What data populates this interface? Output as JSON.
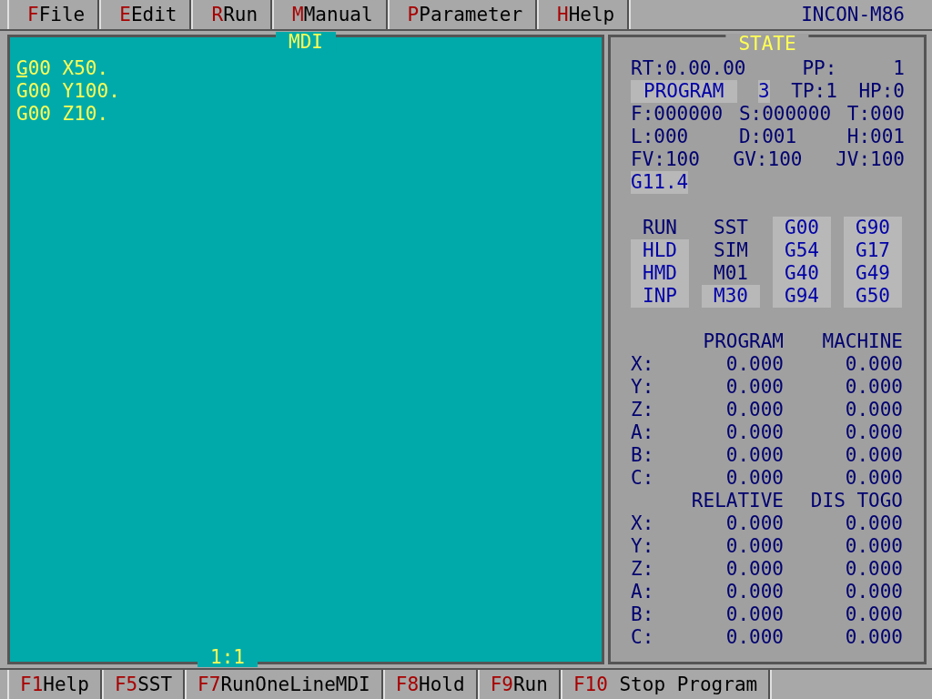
{
  "menu": [
    {
      "key": "F",
      "label": "File"
    },
    {
      "key": "E",
      "label": "Edit"
    },
    {
      "key": "R",
      "label": "Run"
    },
    {
      "key": "M",
      "label": "Manual"
    },
    {
      "key": "P",
      "label": "Parameter"
    },
    {
      "key": "H",
      "label": "Help"
    }
  ],
  "product": "INCON-M86",
  "editor": {
    "title": "MDI",
    "lines": [
      "G00 X50.",
      "G00 Y100.",
      "G00 Z10."
    ],
    "position": "1:1"
  },
  "state": {
    "title": "STATE",
    "rows": [
      [
        {
          "text": "RT:0.00.00",
          "on": false
        },
        {
          "text": "PP:",
          "on": false
        },
        {
          "text": "1",
          "on": false
        }
      ],
      [
        {
          "text": "PROGRAM",
          "on": true
        },
        {
          "text": "3",
          "on": true
        },
        {
          "text": "TP:1",
          "on": false
        },
        {
          "text": "HP:0",
          "on": false
        }
      ],
      [
        {
          "text": "F:000000",
          "on": false
        },
        {
          "text": "S:000000",
          "on": false
        },
        {
          "text": "T:000",
          "on": false
        }
      ],
      [
        {
          "text": "L:000",
          "on": false
        },
        {
          "text": "D:001",
          "on": false
        },
        {
          "text": "H:001",
          "on": false
        }
      ],
      [
        {
          "text": "FV:100",
          "on": false
        },
        {
          "text": "GV:100",
          "on": false
        },
        {
          "text": "JV:100",
          "on": false
        }
      ],
      [
        {
          "text": "G11.4",
          "on": true
        }
      ]
    ],
    "flags": [
      [
        {
          "text": "RUN",
          "on": false
        },
        {
          "text": "SST",
          "on": false
        },
        {
          "text": "G00",
          "on": true
        },
        {
          "text": "G90",
          "on": true
        }
      ],
      [
        {
          "text": "HLD",
          "on": true
        },
        {
          "text": "SIM",
          "on": false
        },
        {
          "text": "G54",
          "on": true
        },
        {
          "text": "G17",
          "on": true
        }
      ],
      [
        {
          "text": "HMD",
          "on": true
        },
        {
          "text": "M01",
          "on": false
        },
        {
          "text": "G40",
          "on": true
        },
        {
          "text": "G49",
          "on": true
        }
      ],
      [
        {
          "text": "INP",
          "on": true
        },
        {
          "text": "M30",
          "on": true
        },
        {
          "text": "G94",
          "on": true
        },
        {
          "text": "G50",
          "on": true
        }
      ]
    ],
    "positions": [
      {
        "headers": [
          "PROGRAM",
          "MACHINE"
        ],
        "rows": [
          {
            "axis": "X:",
            "values": [
              "0.000",
              "0.000"
            ]
          },
          {
            "axis": "Y:",
            "values": [
              "0.000",
              "0.000"
            ]
          },
          {
            "axis": "Z:",
            "values": [
              "0.000",
              "0.000"
            ]
          },
          {
            "axis": "A:",
            "values": [
              "0.000",
              "0.000"
            ]
          },
          {
            "axis": "B:",
            "values": [
              "0.000",
              "0.000"
            ]
          },
          {
            "axis": "C:",
            "values": [
              "0.000",
              "0.000"
            ]
          }
        ]
      },
      {
        "headers": [
          "RELATIVE",
          "DIS TOGO"
        ],
        "rows": [
          {
            "axis": "X:",
            "values": [
              "0.000",
              "0.000"
            ]
          },
          {
            "axis": "Y:",
            "values": [
              "0.000",
              "0.000"
            ]
          },
          {
            "axis": "Z:",
            "values": [
              "0.000",
              "0.000"
            ]
          },
          {
            "axis": "A:",
            "values": [
              "0.000",
              "0.000"
            ]
          },
          {
            "axis": "B:",
            "values": [
              "0.000",
              "0.000"
            ]
          },
          {
            "axis": "C:",
            "values": [
              "0.000",
              "0.000"
            ]
          }
        ]
      }
    ]
  },
  "function_keys": [
    {
      "key": "F1",
      "label": "Help"
    },
    {
      "key": "F5",
      "label": "SST"
    },
    {
      "key": "F7",
      "label": "RunOneLineMDI"
    },
    {
      "key": "F8",
      "label": "Hold"
    },
    {
      "key": "F9",
      "label": "Run"
    },
    {
      "key": "F10",
      "label": " Stop Program"
    }
  ]
}
